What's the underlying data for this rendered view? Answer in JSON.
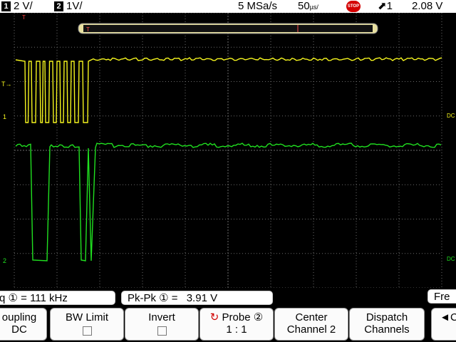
{
  "status": {
    "ch1_num": "1",
    "ch1_scale": "2 V/",
    "ch2_num": "2",
    "ch2_scale": "1V/",
    "sample_rate": "5 MSa/s",
    "timebase": "50",
    "timebase_unit": "µs/",
    "stop_label": "STOP",
    "trigger": "1",
    "trigger_level": "2.08 V"
  },
  "markers": {
    "timeline_t": "T",
    "trigger_t": "T",
    "ch1": "1",
    "ch2": "2",
    "dc_right_1": "DC",
    "dc_right_2": "DC"
  },
  "measurements": [
    {
      "label": "q ① =",
      "value": "111 kHz"
    },
    {
      "label": "Pk-Pk ① =",
      "value": "3.91 V"
    },
    {
      "label": "Fre",
      "value": ""
    }
  ],
  "softkeys": [
    {
      "line1": "oupling",
      "line2": "DC"
    },
    {
      "line1": "BW Limit",
      "line2": ""
    },
    {
      "line1": "Invert",
      "line2": ""
    },
    {
      "line1": "Probe ②",
      "line2": "1 : 1"
    },
    {
      "line1": "Center",
      "line2": "Channel 2"
    },
    {
      "line1": "Dispatch",
      "line2": "Channels"
    },
    {
      "line1": "◄C",
      "line2": ""
    }
  ],
  "colors": {
    "ch1": "#f5f51e",
    "ch2": "#20e020",
    "grid": "#6b6b6b",
    "trigger": "#ff4040"
  }
}
